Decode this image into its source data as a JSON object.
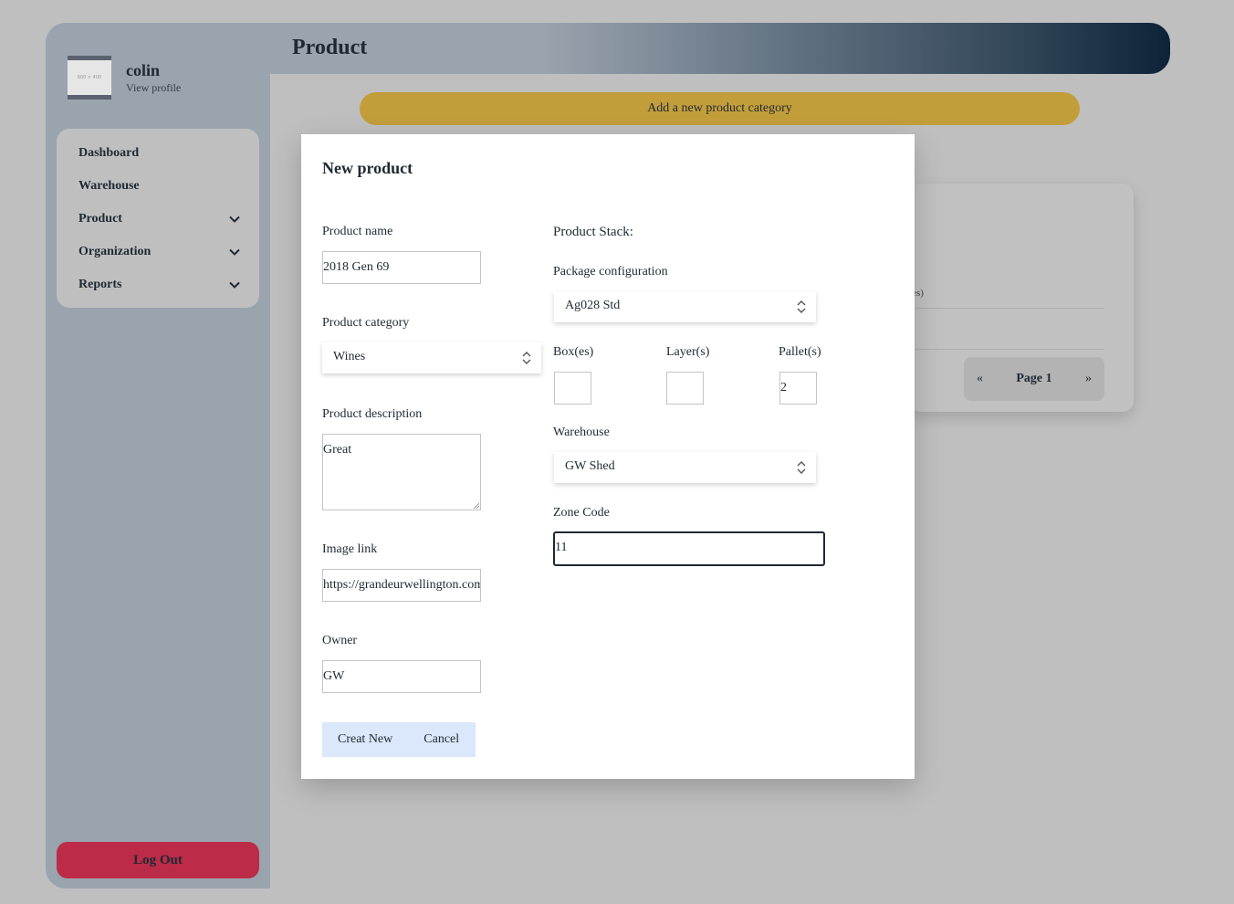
{
  "sidebar": {
    "avatar_placeholder": "600 × 400",
    "username": "colin",
    "view_profile": "View profile",
    "nav": [
      {
        "label": "Dashboard"
      },
      {
        "label": "Warehouse"
      },
      {
        "label": "Product"
      },
      {
        "label": "Organization"
      },
      {
        "label": "Reports"
      }
    ],
    "logout": "Log Out"
  },
  "header": {
    "title": "Product"
  },
  "main": {
    "add_category": "Add a new product category",
    "card_fragment": "les)",
    "pager": {
      "prev": "«",
      "page": "Page 1",
      "next": "»"
    }
  },
  "modal": {
    "title": "New product",
    "product_name": {
      "label": "Product name",
      "value": "2018 Gen 69"
    },
    "product_category": {
      "label": "Product category",
      "value": "Wines"
    },
    "product_description": {
      "label": "Product description",
      "value": "Great"
    },
    "image_link": {
      "label": "Image link",
      "value": "https://grandeurwellington.com"
    },
    "owner": {
      "label": "Owner",
      "value": "GW"
    },
    "stack_heading": "Product Stack:",
    "package_configuration": {
      "label": "Package configuration",
      "value": "Ag028 Std"
    },
    "boxes": {
      "label": "Box(es)",
      "value": ""
    },
    "layers": {
      "label": "Layer(s)",
      "value": ""
    },
    "pallets": {
      "label": "Pallet(s)",
      "value": "2"
    },
    "warehouse": {
      "label": "Warehouse",
      "value": "GW Shed"
    },
    "zone_code": {
      "label": "Zone Code",
      "value": "11"
    },
    "create_button": "Creat New",
    "cancel_button": "Cancel"
  },
  "colors": {
    "background": "#bfbfbf",
    "sidebar": "#9aa4af",
    "add_category": "#c29e3b",
    "logout": "#bc2b47",
    "button_group": "#dbe7fa"
  }
}
